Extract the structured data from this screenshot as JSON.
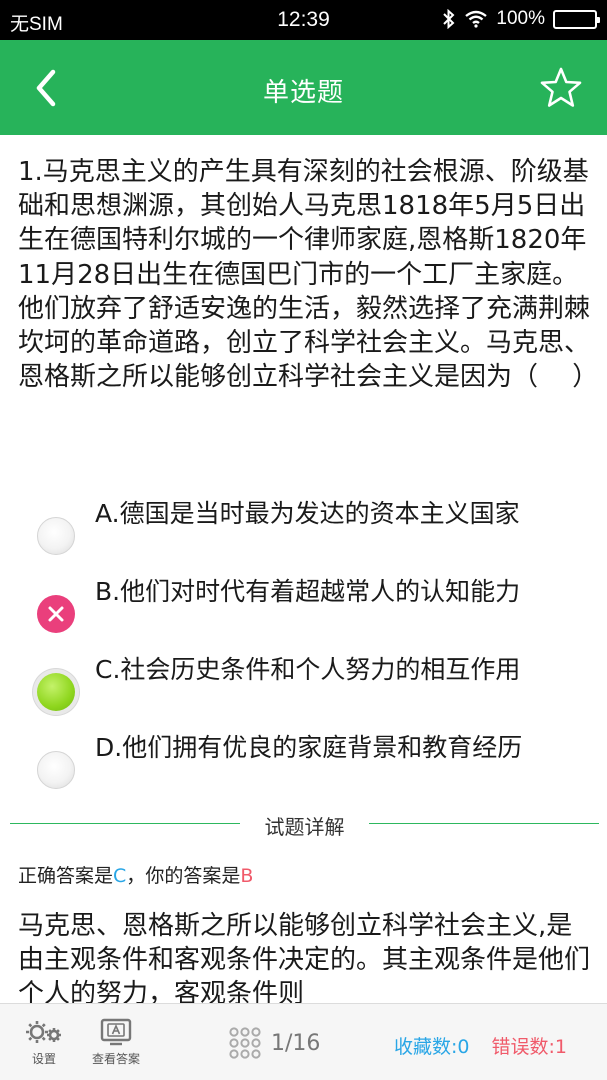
{
  "status_bar": {
    "carrier": "无SIM",
    "time": "12:39",
    "battery": "100%"
  },
  "header": {
    "title": "单选题"
  },
  "question": {
    "text": "1.马克思主义的产生具有深刻的社会根源、阶级基础和思想渊源，其创始人马克思1818年5月5日出生在德国特利尔城的一个律师家庭,恩格斯1820年11月28日出生在德国巴门市的一个工厂主家庭。他们放弃了舒适安逸的生活，毅然选择了充满荆棘坎坷的革命道路，创立了科学社会主义。马克思、恩格斯之所以能够创立科学社会主义是因为（　 ）"
  },
  "options": [
    {
      "label": "A.德国是当时最为发达的资本主义国家",
      "state": "unselected"
    },
    {
      "label": "B.他们对时代有着超越常人的认知能力",
      "state": "wrong"
    },
    {
      "label": "C.社会历史条件和个人努力的相互作用",
      "state": "correct"
    },
    {
      "label": "D.他们拥有优良的家庭背景和教育经历",
      "state": "unselected"
    }
  ],
  "explanation": {
    "heading": "试题详解",
    "correct_prefix": "正确答案是",
    "correct_answer": "C",
    "separator": "，",
    "your_prefix": "你的答案是",
    "your_answer": "B",
    "text": "马克思、恩格斯之所以能够创立科学社会主义,是由主观条件和客观条件决定的。其主观条件是他们个人的努力，客观条件则"
  },
  "bottom_bar": {
    "settings_label": "设置",
    "view_answer_label": "查看答案",
    "page_indicator": "1/16",
    "favorites_label": "收藏数:0",
    "errors_label": "错误数:1"
  },
  "colors": {
    "header_green": "#27b35a",
    "divider_green": "#2db85e",
    "wrong_pink": "#ea3f7c",
    "correct_lime": "#8fd61e",
    "blue_accent": "#29a6e6",
    "red_accent": "#f05a6a"
  }
}
